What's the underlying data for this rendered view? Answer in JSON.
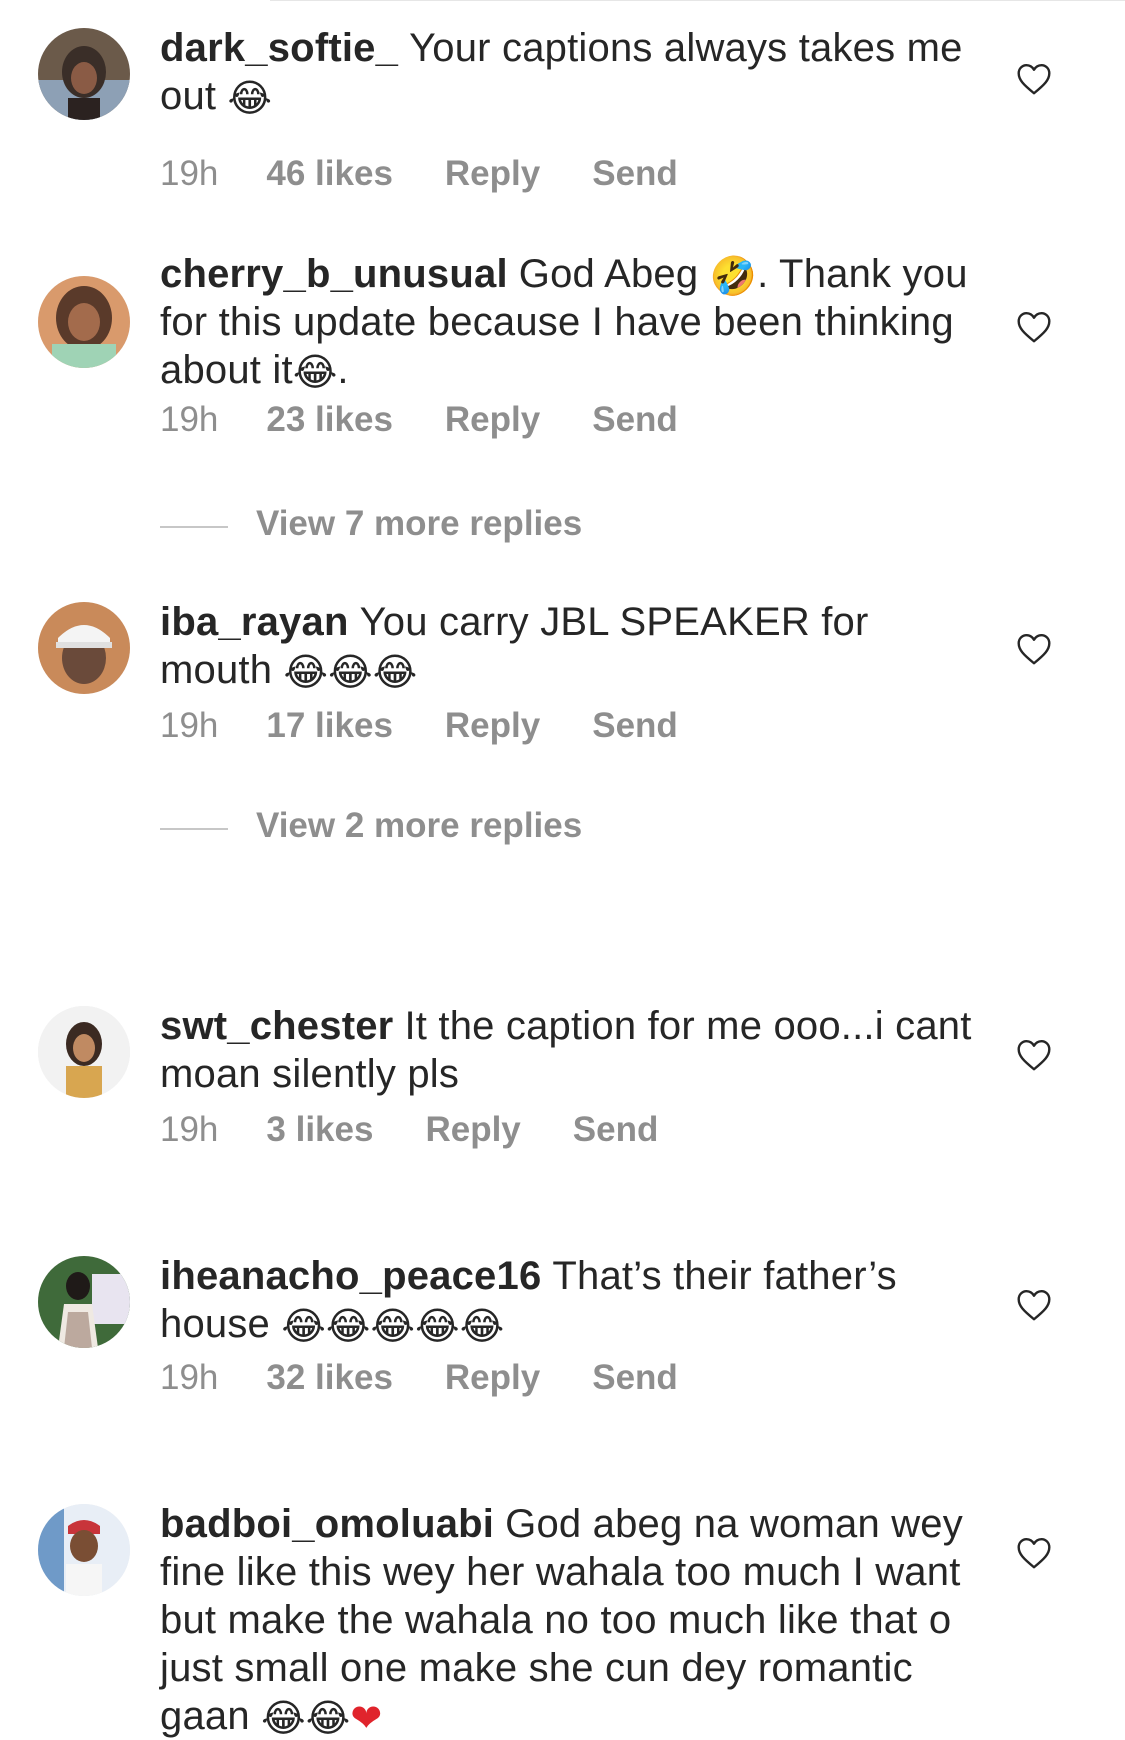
{
  "comments": [
    {
      "username": "dark_softie_",
      "text": "Your captions always takes me out",
      "emoji_after": "😂",
      "time": "19h",
      "likes": "46 likes",
      "reply_label": "Reply",
      "send_label": "Send",
      "avatar_colors": [
        "#6b5a4a",
        "#3a2e28",
        "#c9b7a8"
      ]
    },
    {
      "username": "cherry_b_unusual",
      "text_a": "God Abeg",
      "emoji_a": "🤣",
      "text_b": ". Thank you for this update because I have been thinking about it",
      "emoji_b": "😂",
      "text_c": ".",
      "time": "19h",
      "likes": "23 likes",
      "reply_label": "Reply",
      "send_label": "Send",
      "view_replies": "View 7 more replies",
      "avatar_colors": [
        "#d99a6c",
        "#5a3a2a",
        "#9fd3b5"
      ]
    },
    {
      "username": "iba_rayan",
      "text": "You carry JBL SPEAKER for mouth",
      "emojis": "😂😂😂",
      "time": "19h",
      "likes": "17 likes",
      "reply_label": "Reply",
      "send_label": "Send",
      "view_replies": "View 2 more replies",
      "avatar_colors": [
        "#c98a5a",
        "#f4f4f4",
        "#6a4a3a"
      ]
    },
    {
      "username": "swt_chester",
      "text": "It the caption for me ooo...i cant moan silently pls",
      "time": "19h",
      "likes": "3 likes",
      "reply_label": "Reply",
      "send_label": "Send",
      "avatar_colors": [
        "#e6d2c2",
        "#3b2a22",
        "#d8a650"
      ]
    },
    {
      "username": "iheanacho_peace16",
      "text": "That’s their father’s house",
      "emojis": "😂😂😂😂😂",
      "time": "19h",
      "likes": "32 likes",
      "reply_label": "Reply",
      "send_label": "Send",
      "avatar_colors": [
        "#3f6a3a",
        "#1f1a18",
        "#e8e4f0"
      ]
    },
    {
      "username": "badboi_omoluabi",
      "text": "God abeg na woman wey fine like this wey her wahala too much I want but make the wahala no too much like that o just small one make she cun dey romantic gaan",
      "emojis": "😂😂",
      "heart_emoji": "❤",
      "avatar_colors": [
        "#6f9ac8",
        "#c8343a",
        "#e8eef6"
      ]
    }
  ],
  "colors": {
    "text": "#262626",
    "meta": "#8e8e8e",
    "emoji_heart": "#e0242c"
  },
  "icons": {
    "like": "heart-outline-icon"
  }
}
